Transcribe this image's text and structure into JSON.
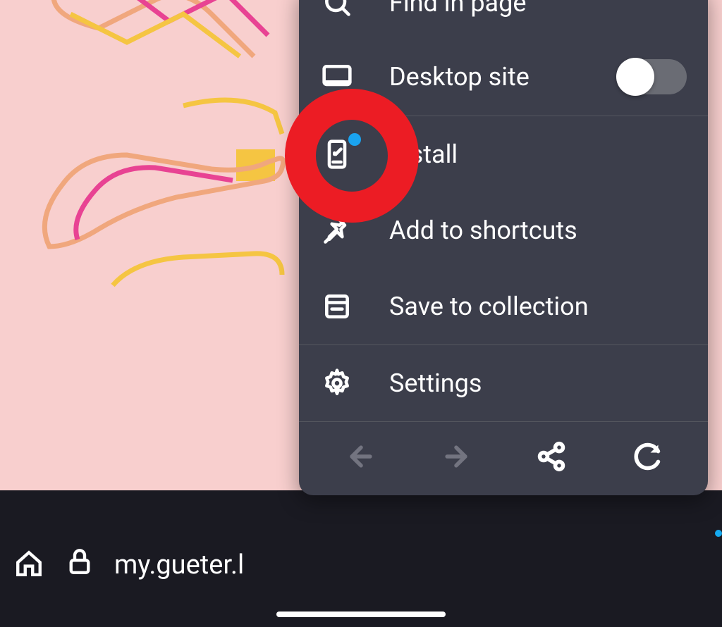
{
  "page": {
    "url": "my.gueter.l"
  },
  "menu": {
    "items": {
      "find": "Find in page",
      "desktop": "Desktop site",
      "install": "Install",
      "shortcuts": "Add to shortcuts",
      "collection": "Save to collection",
      "settings": "Settings"
    },
    "desktop_toggle": false
  }
}
